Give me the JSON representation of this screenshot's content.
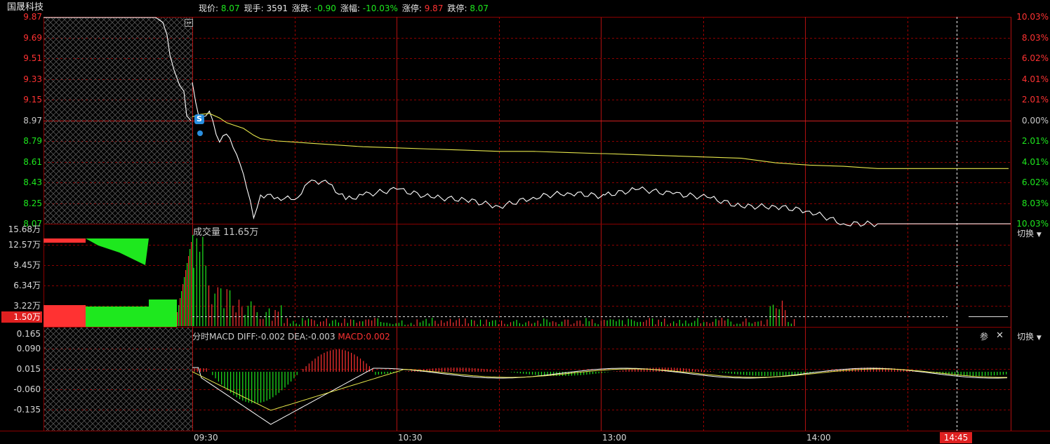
{
  "header": {
    "stock_name": "国晟科技",
    "items": [
      {
        "label": "现价:",
        "value": "8.07",
        "color": "green"
      },
      {
        "label": "现手:",
        "value": "3591",
        "color": "white"
      },
      {
        "label": "涨跌:",
        "value": "-0.90",
        "color": "green"
      },
      {
        "label": "涨幅:",
        "value": "-10.03%",
        "color": "green"
      },
      {
        "label": "涨停:",
        "value": "9.87",
        "color": "red"
      },
      {
        "label": "跌停:",
        "value": "8.07",
        "color": "green"
      }
    ]
  },
  "price_panel": {
    "left_ticks": [
      "9.87",
      "9.69",
      "9.51",
      "9.33",
      "9.15",
      "8.97",
      "8.79",
      "8.61",
      "8.43",
      "8.25",
      "8.07"
    ],
    "right_ticks": [
      "10.03%",
      "8.03%",
      "6.02%",
      "4.01%",
      "2.01%",
      "0.00%",
      "2.01%",
      "4.01%",
      "6.02%",
      "8.03%",
      "10.03%"
    ]
  },
  "volume_panel": {
    "title": "成交量 11.65万",
    "ticks": [
      "15.68万",
      "12.57万",
      "9.45万",
      "6.34万",
      "3.22万"
    ],
    "highlight_tick": "1.50万",
    "switch_label": "切换"
  },
  "macd_panel": {
    "title": "分时MACD",
    "diff": "DIFF:-0.002",
    "dea": "DEA:-0.003",
    "macd": "MACD:0.002",
    "ticks": [
      "0.165",
      "0.090",
      "0.015",
      "-0.060",
      "-0.135"
    ],
    "param_label": "参",
    "close_symbol": "✕",
    "switch_label": "切换"
  },
  "time_axis": {
    "labels": [
      "09:30",
      "10:30",
      "13:00",
      "14:00"
    ],
    "cursor_time": "14:45"
  },
  "signal_marker": "S",
  "colors": {
    "up": "#ff3232",
    "down": "#1ee81e",
    "grid": "#8c0000",
    "price_line": "#ffffff",
    "avg_line": "#e6e64b",
    "cursor": "#ff2020"
  },
  "chart_data": {
    "type": "line",
    "price": {
      "prev_close": 8.97,
      "ylim": [
        8.07,
        9.87
      ],
      "x_time": [
        "09:30",
        "09:32",
        "09:35",
        "09:38",
        "09:40",
        "09:42",
        "09:45",
        "09:48",
        "09:50",
        "09:55",
        "10:00",
        "10:05",
        "10:10",
        "10:15",
        "10:20",
        "10:30",
        "10:40",
        "10:50",
        "11:00",
        "11:10",
        "11:20",
        "11:30",
        "13:00",
        "13:10",
        "13:20",
        "13:30",
        "13:40",
        "13:50",
        "14:00",
        "14:10",
        "14:20"
      ],
      "x_index": [
        0,
        2,
        5,
        8,
        10,
        12,
        15,
        18,
        20,
        25,
        30,
        35,
        40,
        45,
        50,
        60,
        70,
        80,
        90,
        100,
        110,
        120,
        121,
        131,
        141,
        151,
        161,
        171,
        181,
        191,
        201
      ],
      "price": [
        9.3,
        8.99,
        9.05,
        8.78,
        8.85,
        8.73,
        8.5,
        8.12,
        8.32,
        8.3,
        8.28,
        8.45,
        8.42,
        8.28,
        8.32,
        8.37,
        8.3,
        8.28,
        8.22,
        8.3,
        8.34,
        8.31,
        8.32,
        8.37,
        8.33,
        8.3,
        8.22,
        8.22,
        8.18,
        8.07,
        8.07
      ],
      "avg_price": [
        9.0,
        9.02,
        9.03,
        8.99,
        8.95,
        8.93,
        8.9,
        8.84,
        8.81,
        8.79,
        8.78,
        8.77,
        8.76,
        8.75,
        8.74,
        8.73,
        8.72,
        8.71,
        8.7,
        8.7,
        8.69,
        8.68,
        8.68,
        8.67,
        8.66,
        8.65,
        8.64,
        8.6,
        8.58,
        8.57,
        8.55
      ]
    },
    "volume": {
      "ylim": [
        0,
        15.68
      ],
      "unit": "万",
      "current": 11.65,
      "up_value": 1.5
    },
    "macd": {
      "ylim": [
        -0.165,
        0.165
      ],
      "diff": -0.002,
      "dea": -0.003,
      "macd": 0.002
    }
  }
}
